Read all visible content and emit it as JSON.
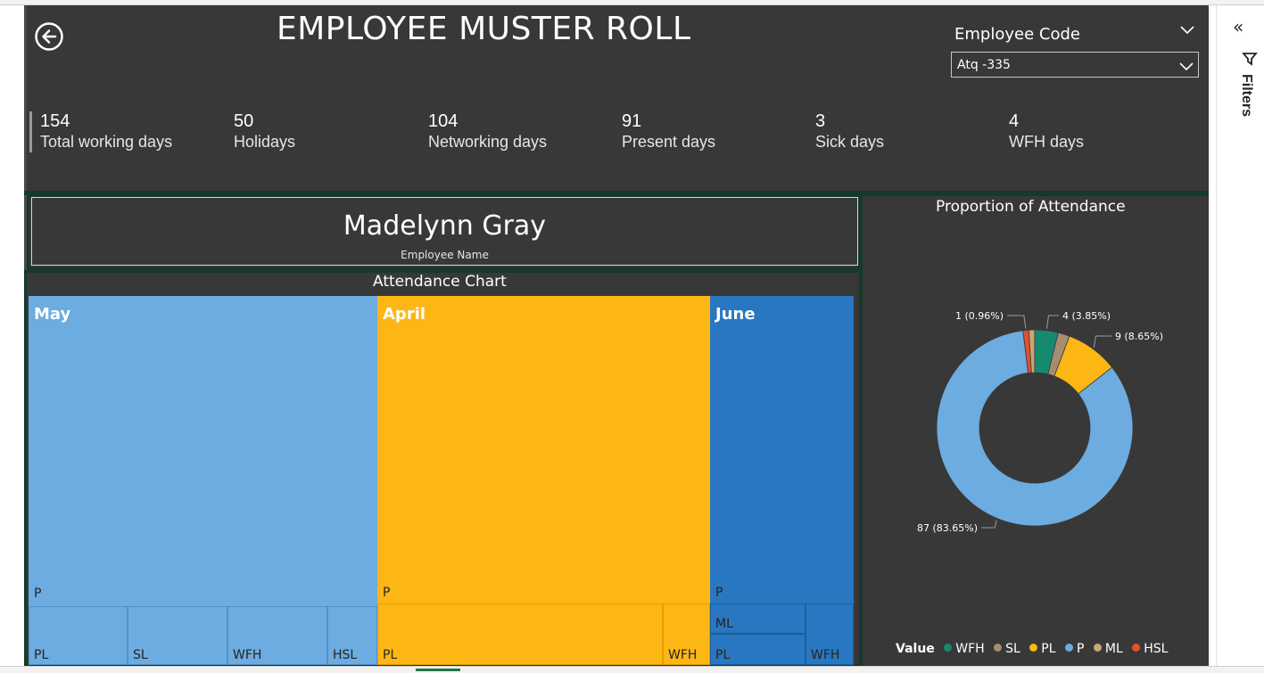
{
  "report": {
    "title": "EMPLOYEE MUSTER ROLL",
    "back_icon": "back-arrow-icon"
  },
  "slicer": {
    "label": "Employee Code",
    "value": "Atq -335"
  },
  "kpis": [
    {
      "value": "154",
      "label": "Total working days"
    },
    {
      "value": "50",
      "label": "Holidays"
    },
    {
      "value": "104",
      "label": "Networking days"
    },
    {
      "value": "91",
      "label": "Present days"
    },
    {
      "value": "3",
      "label": "Sick days"
    },
    {
      "value": "4",
      "label": "WFH days"
    }
  ],
  "employee": {
    "name": "Madelynn Gray",
    "caption": "Employee Name"
  },
  "filters_pane": {
    "label": "Filters",
    "collapse_icon": "double-chevron-left-icon",
    "funnel_icon": "filter-icon"
  },
  "chart_data": [
    {
      "type": "treemap",
      "title": "Attendance Chart",
      "groups": [
        {
          "name": "May",
          "color": "#6cace0",
          "leaves": [
            "P",
            "PL",
            "SL",
            "WFH",
            "HSL"
          ]
        },
        {
          "name": "April",
          "color": "#fdb714",
          "leaves": [
            "P",
            "PL",
            "WFH"
          ]
        },
        {
          "name": "June",
          "color": "#2877c0",
          "leaves": [
            "P",
            "ML",
            "PL",
            "WFH"
          ]
        }
      ]
    },
    {
      "type": "pie",
      "subtype": "donut",
      "title": "Proportion of Attendance",
      "legend_title": "Value",
      "legend_position": "bottom",
      "slices": [
        {
          "name": "WFH",
          "value": 4,
          "label": "4 (3.85%)",
          "color": "#168a6f"
        },
        {
          "name": "SL",
          "value": 2,
          "label": "",
          "color": "#a58d6f"
        },
        {
          "name": "PL",
          "value": 9,
          "label": "9 (8.65%)",
          "color": "#fdb714"
        },
        {
          "name": "P",
          "value": 87,
          "label": "87 (83.65%)",
          "color": "#6cace0"
        },
        {
          "name": "ML",
          "value": 1,
          "label": "",
          "color": "#c9a777"
        },
        {
          "name": "HSL",
          "value": 1,
          "label": "1 (0.96%)",
          "color": "#e4502b"
        }
      ]
    }
  ]
}
